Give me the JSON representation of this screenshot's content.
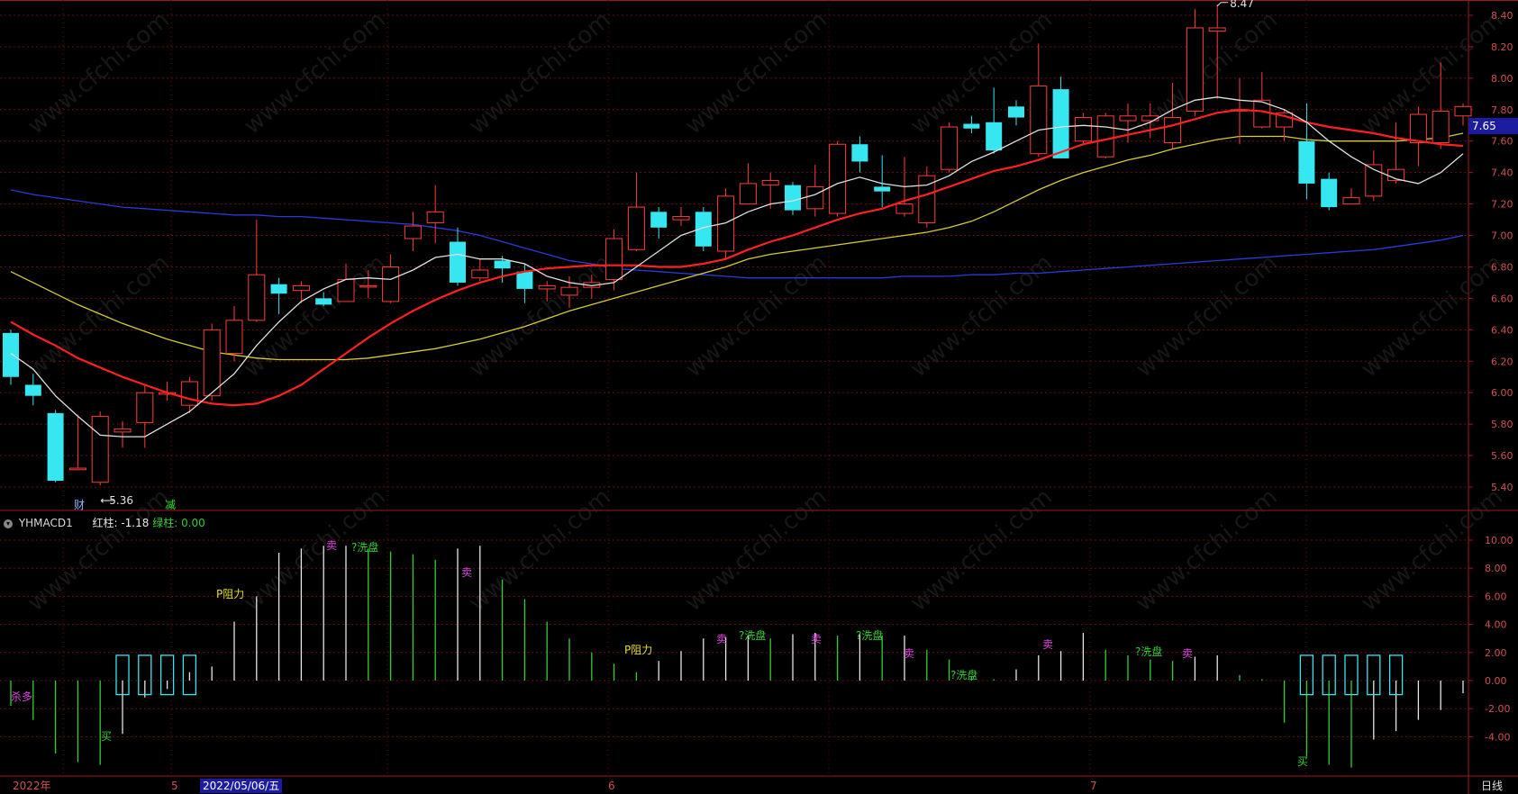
{
  "period_label": "日线",
  "indicator": {
    "name": "YHMACD1",
    "red_label": "红柱:",
    "red_value": "-1.18",
    "green_label": "绿柱:",
    "green_value": "0.00"
  },
  "x_labels": {
    "year": "2022年",
    "may": "5",
    "cursor_date": "2022/05/06/五",
    "jun": "6",
    "jul": "7"
  },
  "price_markers": {
    "high": "8.47",
    "low": "5.36",
    "current": "7.65"
  },
  "event_labels": {
    "cai": "财",
    "jian": "减"
  },
  "signal_texts": {
    "sell": "卖",
    "buy": "买",
    "shaduo": "杀多",
    "zuli": "P阻力",
    "xipan": "?洗盘"
  },
  "watermark": "www.cfchi.com",
  "colors": {
    "up": "#ff3b3b",
    "down": "#36e6f0",
    "ma5": "#e0e0e0",
    "ma10": "#ff2020",
    "ma20": "#d4cc30",
    "ma60": "#2a3ad8",
    "grid": "#6a1010"
  },
  "chart_data": [
    {
      "type": "candlestick",
      "ylim": [
        5.2,
        8.5
      ],
      "y_ticks": [
        "8.40",
        "8.20",
        "8.00",
        "7.80",
        "7.60",
        "7.40",
        "7.20",
        "7.00",
        "6.80",
        "6.60",
        "6.40",
        "6.20",
        "6.00",
        "5.80",
        "5.60",
        "5.40"
      ],
      "candles": [
        [
          6.38,
          6.1,
          6.4,
          6.05
        ],
        [
          6.05,
          5.98,
          6.12,
          5.92
        ],
        [
          5.87,
          5.44,
          5.89,
          5.43
        ],
        [
          5.51,
          5.52,
          5.86,
          5.51
        ],
        [
          5.43,
          5.85,
          5.88,
          5.41
        ],
        [
          5.75,
          5.77,
          5.82,
          5.65
        ],
        [
          5.81,
          6.0,
          6.05,
          5.65
        ],
        [
          5.99,
          6.0,
          6.07,
          5.95
        ],
        [
          5.92,
          6.07,
          6.1,
          5.87
        ],
        [
          5.98,
          6.4,
          6.44,
          5.95
        ],
        [
          6.25,
          6.46,
          6.55,
          6.2
        ],
        [
          6.46,
          6.75,
          7.1,
          6.45
        ],
        [
          6.69,
          6.63,
          6.73,
          6.5
        ],
        [
          6.65,
          6.68,
          6.71,
          6.57
        ],
        [
          6.6,
          6.56,
          6.64,
          6.55
        ],
        [
          6.58,
          6.72,
          6.82,
          6.58
        ],
        [
          6.68,
          6.68,
          6.78,
          6.6
        ],
        [
          6.58,
          6.8,
          6.88,
          6.57
        ],
        [
          6.98,
          7.06,
          7.15,
          6.9
        ],
        [
          7.08,
          7.15,
          7.32,
          6.95
        ],
        [
          6.96,
          6.7,
          7.05,
          6.68
        ],
        [
          6.73,
          6.78,
          6.85,
          6.71
        ],
        [
          6.84,
          6.79,
          6.87,
          6.7
        ],
        [
          6.77,
          6.66,
          6.82,
          6.57
        ],
        [
          6.66,
          6.68,
          6.71,
          6.58
        ],
        [
          6.62,
          6.67,
          6.74,
          6.54
        ],
        [
          6.67,
          6.7,
          6.75,
          6.6
        ],
        [
          6.72,
          6.98,
          7.04,
          6.65
        ],
        [
          6.91,
          7.18,
          7.4,
          6.9
        ],
        [
          7.15,
          7.05,
          7.18,
          6.98
        ],
        [
          7.1,
          7.12,
          7.18,
          7.06
        ],
        [
          7.15,
          6.93,
          7.18,
          6.9
        ],
        [
          6.9,
          7.25,
          7.3,
          6.85
        ],
        [
          7.2,
          7.33,
          7.46,
          7.2
        ],
        [
          7.32,
          7.35,
          7.4,
          7.17
        ],
        [
          7.32,
          7.16,
          7.34,
          7.13
        ],
        [
          7.17,
          7.31,
          7.45,
          7.12
        ],
        [
          7.14,
          7.58,
          7.6,
          7.12
        ],
        [
          7.58,
          7.47,
          7.63,
          7.4
        ],
        [
          7.31,
          7.28,
          7.51,
          7.18
        ],
        [
          7.14,
          7.2,
          7.5,
          7.12
        ],
        [
          7.08,
          7.38,
          7.44,
          7.05
        ],
        [
          7.42,
          7.69,
          7.72,
          7.4
        ],
        [
          7.71,
          7.68,
          7.76,
          7.65
        ],
        [
          7.72,
          7.54,
          7.94,
          7.52
        ],
        [
          7.82,
          7.75,
          7.86,
          7.7
        ],
        [
          7.52,
          7.95,
          8.22,
          7.5
        ],
        [
          7.93,
          7.49,
          8.01,
          7.49
        ],
        [
          7.6,
          7.75,
          7.78,
          7.58
        ],
        [
          7.5,
          7.76,
          7.78,
          7.49
        ],
        [
          7.73,
          7.76,
          7.84,
          7.59
        ],
        [
          7.73,
          7.76,
          7.84,
          7.62
        ],
        [
          7.59,
          7.75,
          7.97,
          7.55
        ],
        [
          7.79,
          8.32,
          8.44,
          7.76
        ],
        [
          8.3,
          8.32,
          8.47,
          7.87
        ],
        [
          7.8,
          7.8,
          8.0,
          7.58
        ],
        [
          7.69,
          7.86,
          8.04,
          7.68
        ],
        [
          7.69,
          7.78,
          7.8,
          7.6
        ],
        [
          7.6,
          7.33,
          7.84,
          7.23
        ],
        [
          7.36,
          7.18,
          7.4,
          7.16
        ],
        [
          7.2,
          7.24,
          7.3,
          7.2
        ],
        [
          7.25,
          7.45,
          7.54,
          7.22
        ],
        [
          7.35,
          7.42,
          7.72,
          7.33
        ],
        [
          7.59,
          7.77,
          7.82,
          7.44
        ],
        [
          7.59,
          7.79,
          8.1,
          7.55
        ],
        [
          7.76,
          7.82,
          7.84,
          7.7
        ]
      ],
      "ma5": [
        6.25,
        6.15,
        5.98,
        5.85,
        5.73,
        5.72,
        5.72,
        5.8,
        5.88,
        6.0,
        6.12,
        6.3,
        6.45,
        6.58,
        6.66,
        6.72,
        6.73,
        6.72,
        6.78,
        6.86,
        6.88,
        6.85,
        6.85,
        6.82,
        6.74,
        6.7,
        6.68,
        6.7,
        6.8,
        6.9,
        7.0,
        7.05,
        7.08,
        7.15,
        7.2,
        7.22,
        7.26,
        7.33,
        7.37,
        7.33,
        7.31,
        7.32,
        7.38,
        7.47,
        7.53,
        7.6,
        7.67,
        7.69,
        7.7,
        7.69,
        7.67,
        7.72,
        7.8,
        7.86,
        7.88,
        7.86,
        7.85,
        7.8,
        7.72,
        7.6,
        7.5,
        7.42,
        7.36,
        7.33,
        7.4,
        7.52
      ],
      "ma10": [
        6.45,
        6.37,
        6.3,
        6.22,
        6.16,
        6.1,
        6.05,
        6.0,
        5.96,
        5.93,
        5.92,
        5.93,
        5.98,
        6.05,
        6.15,
        6.25,
        6.35,
        6.44,
        6.52,
        6.59,
        6.65,
        6.7,
        6.74,
        6.77,
        6.79,
        6.8,
        6.81,
        6.81,
        6.81,
        6.8,
        6.8,
        6.82,
        6.85,
        6.91,
        6.96,
        7.0,
        7.05,
        7.1,
        7.14,
        7.17,
        7.22,
        7.26,
        7.31,
        7.36,
        7.41,
        7.44,
        7.48,
        7.53,
        7.58,
        7.61,
        7.64,
        7.67,
        7.7,
        7.74,
        7.78,
        7.8,
        7.79,
        7.76,
        7.72,
        7.69,
        7.67,
        7.65,
        7.62,
        7.6,
        7.58,
        7.57
      ],
      "ma20": [
        6.77,
        6.7,
        6.63,
        6.56,
        6.5,
        6.44,
        6.39,
        6.34,
        6.3,
        6.26,
        6.24,
        6.22,
        6.21,
        6.21,
        6.21,
        6.21,
        6.22,
        6.24,
        6.26,
        6.28,
        6.31,
        6.34,
        6.38,
        6.42,
        6.47,
        6.52,
        6.56,
        6.6,
        6.64,
        6.68,
        6.72,
        6.76,
        6.8,
        6.85,
        6.88,
        6.9,
        6.92,
        6.94,
        6.96,
        6.98,
        7.0,
        7.02,
        7.05,
        7.09,
        7.15,
        7.22,
        7.29,
        7.35,
        7.4,
        7.44,
        7.48,
        7.51,
        7.55,
        7.58,
        7.61,
        7.63,
        7.63,
        7.63,
        7.61,
        7.6,
        7.6,
        7.6,
        7.6,
        7.61,
        7.62,
        7.65
      ],
      "ma60": [
        7.29,
        7.26,
        7.24,
        7.22,
        7.2,
        7.18,
        7.17,
        7.16,
        7.15,
        7.14,
        7.13,
        7.13,
        7.12,
        7.12,
        7.11,
        7.1,
        7.09,
        7.08,
        7.07,
        7.05,
        7.03,
        7.0,
        6.96,
        6.92,
        6.88,
        6.84,
        6.82,
        6.79,
        6.78,
        6.77,
        6.76,
        6.75,
        6.74,
        6.73,
        6.73,
        6.73,
        6.73,
        6.73,
        6.73,
        6.73,
        6.74,
        6.74,
        6.74,
        6.75,
        6.75,
        6.76,
        6.76,
        6.77,
        6.78,
        6.79,
        6.8,
        6.81,
        6.82,
        6.83,
        6.84,
        6.85,
        6.86,
        6.87,
        6.88,
        6.89,
        6.9,
        6.91,
        6.93,
        6.95,
        6.97,
        7.0
      ]
    },
    {
      "type": "bar",
      "name": "YHMACD1",
      "ylim": [
        -6.5,
        11.5
      ],
      "y_ticks": [
        "10.00",
        "8.00",
        "6.00",
        "4.00",
        "2.00",
        "0.00",
        "-2.00",
        "-4.00"
      ],
      "values": [
        -1.8,
        -2.8,
        -5.2,
        -5.8,
        -6.0,
        -3.8,
        -1.2,
        -0.6,
        0.6,
        1.0,
        4.2,
        6.0,
        9.1,
        9.4,
        9.6,
        9.6,
        9.4,
        9.2,
        9.0,
        8.6,
        9.4,
        9.6,
        7.2,
        5.8,
        4.2,
        3.0,
        2.0,
        1.2,
        0.6,
        1.4,
        2.1,
        3.0,
        3.1,
        3.2,
        3.0,
        3.3,
        3.4,
        3.2,
        3.3,
        3.2,
        3.2,
        2.2,
        1.5,
        0.3,
        0.1,
        0.8,
        1.8,
        2.1,
        3.4,
        2.2,
        1.8,
        1.5,
        1.4,
        1.7,
        1.8,
        0.4,
        0.1,
        -3.0,
        -5.4,
        -6.0,
        -6.2,
        -4.2,
        -3.6,
        -2.8,
        -2.1,
        -0.9
      ],
      "colors_rule": "white when rising, green when falling"
    }
  ]
}
